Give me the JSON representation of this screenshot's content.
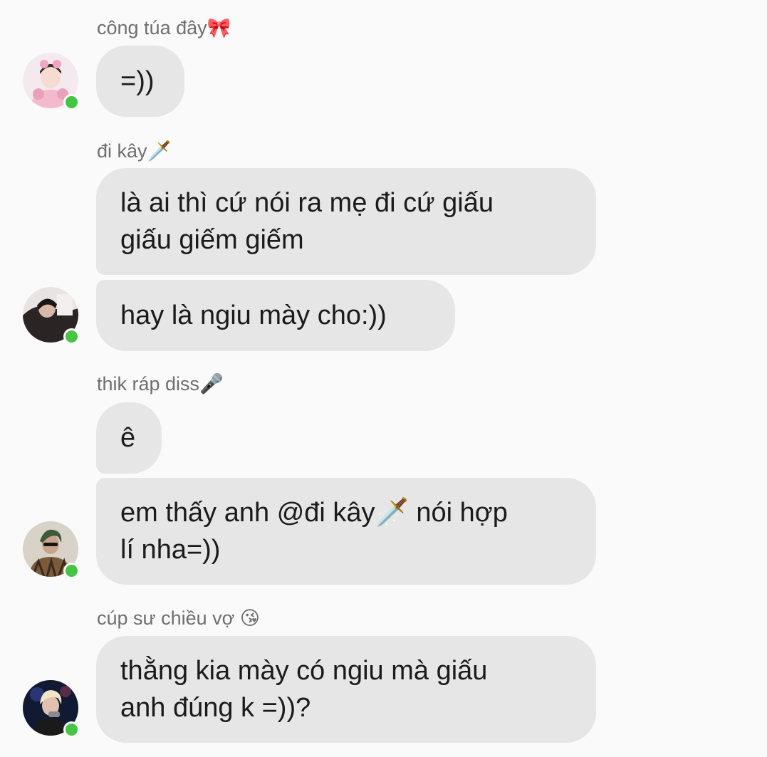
{
  "messages": [
    {
      "sender": "công túa đây🎀",
      "bubbles": [
        "=))"
      ]
    },
    {
      "sender": "đi kây🗡️",
      "bubbles": [
        "là ai thì cứ nói ra mẹ đi cứ giấu\ngiấu giếm giếm",
        "hay là ngiu mày cho:))"
      ]
    },
    {
      "sender": "thik ráp diss🎤",
      "bubbles": [
        "ê",
        "em thấy anh @đi kây🗡️ nói hợp\nlí nha=))"
      ]
    },
    {
      "sender": "cúp sư chiều vợ 😘",
      "bubbles": [
        "thằng kia mày có ngiu mà giấu\nanh đúng k =))?"
      ]
    }
  ],
  "colors": {
    "background": "#fafafa",
    "bubble": "#e6e6e6",
    "online": "#46c443",
    "sender_text": "#6f6f6f"
  }
}
